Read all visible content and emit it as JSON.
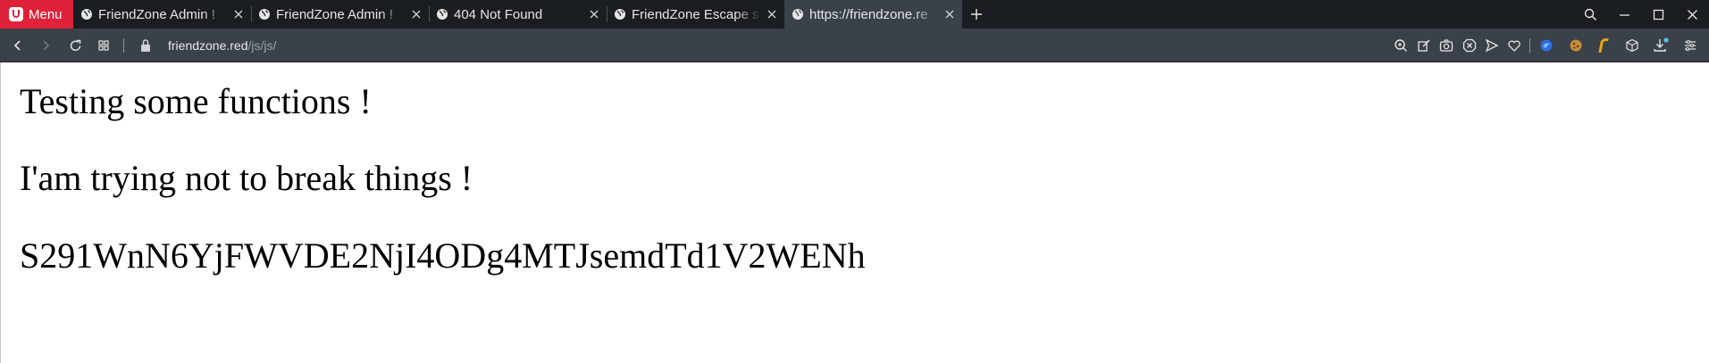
{
  "menu": {
    "label": "Menu"
  },
  "tabs": [
    {
      "title": "FriendZone Admin !",
      "active": false,
      "icon": "globe-icon"
    },
    {
      "title": "FriendZone Admin !",
      "active": false,
      "icon": "globe-icon"
    },
    {
      "title": "404 Not Found",
      "active": false,
      "icon": "globe-icon"
    },
    {
      "title": "FriendZone Escape s",
      "active": false,
      "icon": "globe-icon"
    },
    {
      "title": "https://friendzone.re",
      "active": true,
      "icon": "globe-icon"
    }
  ],
  "address": {
    "host": "friendzone.red",
    "path": "/js/js/"
  },
  "content": {
    "line1": "Testing some functions !",
    "line2": "I'am trying not to break things !",
    "line3": "S291WnN6YjFWVDE2NjI4ODg4MTJsemdTd1V2WENh"
  },
  "colors": {
    "menu_red": "#e0213a",
    "tabbar_bg": "#1a1d22",
    "active_tab_bg": "#3a4149",
    "page_bg": "#ffffff"
  },
  "icons": {
    "window": [
      "search-icon",
      "minimize-icon",
      "maximize-icon",
      "close-window-icon"
    ],
    "nav": [
      "back-icon",
      "forward-icon",
      "reload-icon",
      "speed-dial-icon",
      "lock-icon"
    ],
    "toolbar": [
      "zoom-icon",
      "edit-icon",
      "camera-icon",
      "block-icon",
      "send-icon",
      "heart-icon",
      "extension-blue-icon",
      "cookie-icon",
      "extension-orange-icon",
      "cube-icon",
      "download-icon",
      "panel-menu-icon"
    ]
  }
}
